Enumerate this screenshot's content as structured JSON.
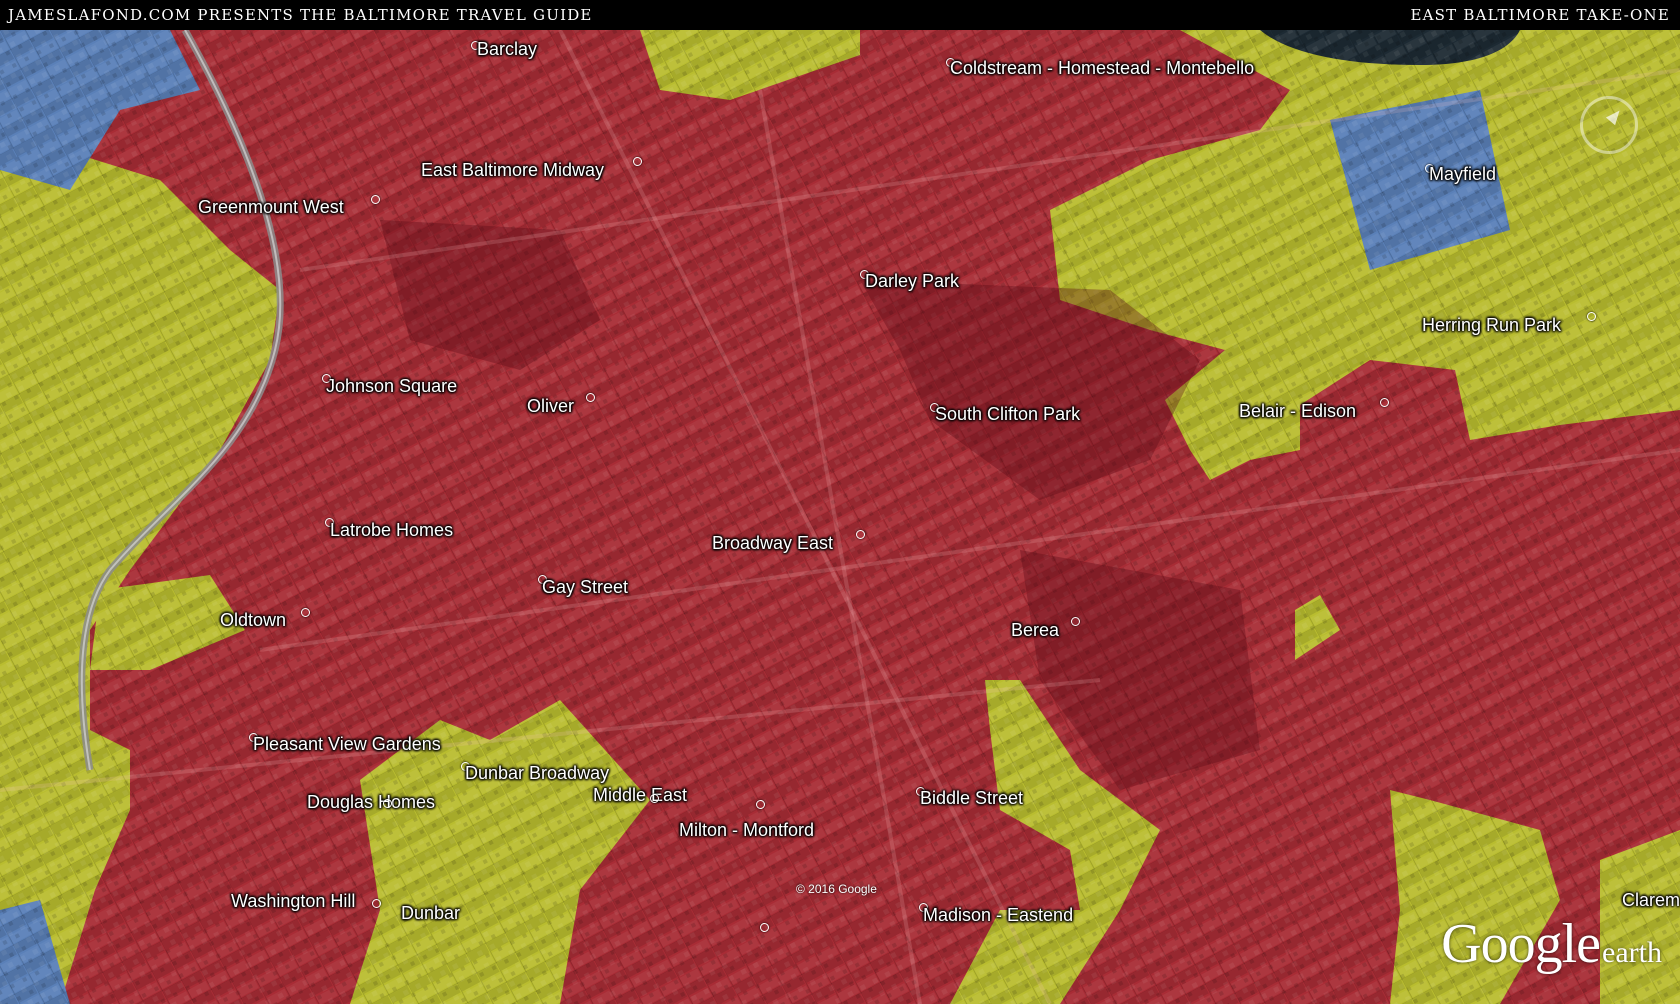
{
  "banner": {
    "left_text": "JamesLaFond.com Presents the Baltimore Travel Guide",
    "right_text": "East Baltimore Take-One"
  },
  "colors": {
    "red_zone": "#b0303a",
    "yellow_zone": "#c2c432",
    "blue_zone": "#5c84b8",
    "banner_bg": "#000000",
    "label_text": "#ffffff"
  },
  "places": [
    {
      "name": "Barclay"
    },
    {
      "name": "Coldstream - Homestead - Montebello"
    },
    {
      "name": "East Baltimore Midway"
    },
    {
      "name": "Greenmount West"
    },
    {
      "name": "Mayfield"
    },
    {
      "name": "Darley Park"
    },
    {
      "name": "Herring Run Park"
    },
    {
      "name": "Johnson Square"
    },
    {
      "name": "Oliver"
    },
    {
      "name": "South Clifton Park"
    },
    {
      "name": "Belair - Edison"
    },
    {
      "name": "Latrobe Homes"
    },
    {
      "name": "Broadway East"
    },
    {
      "name": "Gay Street"
    },
    {
      "name": "Oldtown"
    },
    {
      "name": "Berea"
    },
    {
      "name": "Pleasant View Gardens"
    },
    {
      "name": "Dunbar Broadway"
    },
    {
      "name": "Middle East"
    },
    {
      "name": "Douglas Homes"
    },
    {
      "name": "Biddle Street"
    },
    {
      "name": "Milton - Montford"
    },
    {
      "name": "Washington Hill"
    },
    {
      "name": "Dunbar"
    },
    {
      "name": "Madison - Eastend"
    },
    {
      "name": "Clarem"
    }
  ],
  "map_credit": "© 2016 Google",
  "logo": {
    "google": "Google",
    "earth": "earth"
  },
  "icons": {
    "compass": "compass-icon",
    "pin": "placemark-icon"
  }
}
